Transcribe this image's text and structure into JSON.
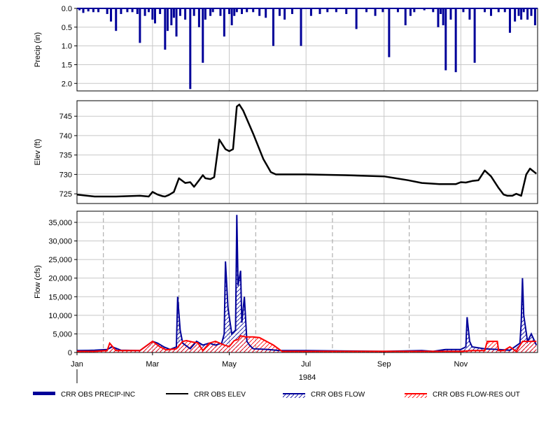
{
  "chart_data": [
    {
      "type": "bar",
      "ylabel": "Precip (in)",
      "ylim": [
        2.2,
        0.0
      ],
      "y_inverted": true,
      "yticks": [
        "0.0",
        "0.5",
        "1.0",
        "1.5",
        "2.0"
      ],
      "grid": true,
      "series": [
        {
          "name": "CRR OBS PRECIP-INC",
          "color": "#000099",
          "x": [
            "1984-01-03",
            "1984-01-06",
            "1984-01-10",
            "1984-01-14",
            "1984-01-18",
            "1984-01-25",
            "1984-01-28",
            "1984-02-01",
            "1984-02-05",
            "1984-02-10",
            "1984-02-14",
            "1984-02-18",
            "1984-02-20",
            "1984-02-24",
            "1984-02-27",
            "1984-03-01",
            "1984-03-03",
            "1984-03-07",
            "1984-03-11",
            "1984-03-13",
            "1984-03-16",
            "1984-03-18",
            "1984-03-20",
            "1984-03-23",
            "1984-03-27",
            "1984-03-31",
            "1984-04-03",
            "1984-04-07",
            "1984-04-10",
            "1984-04-12",
            "1984-04-16",
            "1984-04-18",
            "1984-04-24",
            "1984-04-27",
            "1984-05-01",
            "1984-05-03",
            "1984-05-05",
            "1984-05-07",
            "1984-05-11",
            "1984-05-15",
            "1984-05-20",
            "1984-05-25",
            "1984-05-30",
            "1984-06-05",
            "1984-06-10",
            "1984-06-14",
            "1984-06-20",
            "1984-06-27",
            "1984-07-05",
            "1984-07-12",
            "1984-07-18",
            "1984-07-25",
            "1984-08-02",
            "1984-08-10",
            "1984-08-18",
            "1984-08-25",
            "1984-08-31",
            "1984-09-05",
            "1984-09-12",
            "1984-09-18",
            "1984-09-22",
            "1984-09-25",
            "1984-10-03",
            "1984-10-10",
            "1984-10-14",
            "1984-10-16",
            "1984-10-18",
            "1984-10-20",
            "1984-10-24",
            "1984-10-28",
            "1984-11-03",
            "1984-11-08",
            "1984-11-12",
            "1984-11-20",
            "1984-11-25",
            "1984-12-01",
            "1984-12-06",
            "1984-12-10",
            "1984-12-14",
            "1984-12-17",
            "1984-12-19",
            "1984-12-21",
            "1984-12-24",
            "1984-12-27",
            "1984-12-30"
          ],
          "values": [
            0.05,
            0.12,
            0.08,
            0.1,
            0.1,
            0.15,
            0.35,
            0.6,
            0.15,
            0.1,
            0.1,
            0.15,
            0.92,
            0.2,
            0.1,
            0.3,
            0.4,
            0.15,
            1.1,
            0.6,
            0.45,
            0.25,
            0.75,
            0.2,
            0.3,
            2.15,
            0.2,
            0.5,
            1.45,
            0.3,
            0.2,
            0.1,
            0.2,
            0.75,
            0.15,
            0.45,
            0.2,
            0.1,
            0.15,
            0.1,
            0.1,
            0.2,
            0.25,
            1.0,
            0.2,
            0.3,
            0.15,
            1.0,
            0.2,
            0.15,
            0.1,
            0.1,
            0.15,
            0.55,
            0.1,
            0.2,
            0.1,
            1.3,
            0.1,
            0.45,
            0.2,
            0.1,
            0.05,
            0.1,
            0.5,
            0.15,
            0.45,
            1.65,
            0.3,
            1.7,
            0.1,
            0.3,
            1.45,
            0.1,
            0.2,
            0.1,
            0.1,
            0.65,
            0.35,
            0.2,
            0.3,
            0.1,
            0.3,
            0.2,
            0.45
          ]
        }
      ]
    },
    {
      "type": "line",
      "ylabel": "Elev (ft)",
      "ylim": [
        722.5,
        749
      ],
      "yticks": [
        "725",
        "730",
        "735",
        "740",
        "745"
      ],
      "grid": true,
      "series": [
        {
          "name": "CRR OBS ELEV",
          "color": "#000000",
          "x": [
            "1984-01-01",
            "1984-01-15",
            "1984-02-01",
            "1984-02-20",
            "1984-02-27",
            "1984-03-01",
            "1984-03-05",
            "1984-03-09",
            "1984-03-11",
            "1984-03-14",
            "1984-03-18",
            "1984-03-22",
            "1984-03-27",
            "1984-03-31",
            "1984-04-03",
            "1984-04-07",
            "1984-04-10",
            "1984-04-12",
            "1984-04-16",
            "1984-04-19",
            "1984-04-23",
            "1984-04-28",
            "1984-05-01",
            "1984-05-04",
            "1984-05-07",
            "1984-05-09",
            "1984-05-12",
            "1984-05-20",
            "1984-05-28",
            "1984-06-03",
            "1984-06-07",
            "1984-06-15",
            "1984-07-01",
            "1984-08-01",
            "1984-09-01",
            "1984-09-20",
            "1984-10-01",
            "1984-10-15",
            "1984-10-20",
            "1984-10-28",
            "1984-11-01",
            "1984-11-05",
            "1984-11-10",
            "1984-11-15",
            "1984-11-20",
            "1984-11-25",
            "1984-12-01",
            "1984-12-05",
            "1984-12-08",
            "1984-12-12",
            "1984-12-15",
            "1984-12-19",
            "1984-12-23",
            "1984-12-26",
            "1984-12-31"
          ],
          "values": [
            724.8,
            724.3,
            724.3,
            724.5,
            724.3,
            725.5,
            724.8,
            724.4,
            724.3,
            724.7,
            725.5,
            729.0,
            727.8,
            728.0,
            726.8,
            728.5,
            729.8,
            729.0,
            728.8,
            729.3,
            739.0,
            736.5,
            736.0,
            736.5,
            747.5,
            748.0,
            746.5,
            740.5,
            734.0,
            730.6,
            730.0,
            730.0,
            730.0,
            729.8,
            729.5,
            728.5,
            727.8,
            727.5,
            727.5,
            727.5,
            728.0,
            727.9,
            728.3,
            728.5,
            731.0,
            729.5,
            726.5,
            724.8,
            724.5,
            724.5,
            725.0,
            724.5,
            730.0,
            731.5,
            730.2
          ]
        }
      ]
    },
    {
      "type": "area",
      "ylabel": "Flow (cfs)",
      "ylim": [
        0,
        38000
      ],
      "yticks": [
        "0",
        "5,000",
        "10,000",
        "15,000",
        "20,000",
        "25,000",
        "30,000",
        "35,000"
      ],
      "xlabel": "1984",
      "xticks": [
        "Jan",
        "Mar",
        "May",
        "Jul",
        "Sep",
        "Nov"
      ],
      "grid": true,
      "series": [
        {
          "name": "CRR OBS FLOW",
          "color": "#000099",
          "x": [
            "1984-01-01",
            "1984-01-15",
            "1984-01-25",
            "1984-01-29",
            "1984-02-05",
            "1984-02-20",
            "1984-03-01",
            "1984-03-05",
            "1984-03-10",
            "1984-03-15",
            "1984-03-20",
            "1984-03-21",
            "1984-03-23",
            "1984-03-25",
            "1984-03-31",
            "1984-04-05",
            "1984-04-10",
            "1984-04-15",
            "1984-04-20",
            "1984-04-25",
            "1984-04-27",
            "1984-04-28",
            "1984-04-30",
            "1984-05-03",
            "1984-05-06",
            "1984-05-07",
            "1984-05-08",
            "1984-05-10",
            "1984-05-11",
            "1984-05-13",
            "1984-05-15",
            "1984-05-17",
            "1984-05-20",
            "1984-06-01",
            "1984-06-10",
            "1984-07-01",
            "1984-08-01",
            "1984-09-01",
            "1984-10-01",
            "1984-10-10",
            "1984-10-20",
            "1984-11-01",
            "1984-11-05",
            "1984-11-06",
            "1984-11-08",
            "1984-11-10",
            "1984-11-20",
            "1984-12-01",
            "1984-12-10",
            "1984-12-18",
            "1984-12-19",
            "1984-12-20",
            "1984-12-21",
            "1984-12-24",
            "1984-12-27",
            "1984-12-31"
          ],
          "values": [
            500,
            600,
            800,
            1500,
            600,
            500,
            3000,
            2500,
            1500,
            800,
            1500,
            15000,
            6000,
            2500,
            1000,
            3000,
            2000,
            2500,
            2000,
            2500,
            5000,
            24500,
            12000,
            5000,
            6000,
            37000,
            18000,
            22000,
            8000,
            15000,
            3000,
            2000,
            1000,
            800,
            500,
            500,
            400,
            300,
            500,
            300,
            800,
            800,
            1500,
            9500,
            3000,
            1500,
            1000,
            800,
            600,
            2500,
            8000,
            20000,
            10000,
            3000,
            5000,
            2000
          ]
        },
        {
          "name": "CRR OBS FLOW-RES OUT",
          "color": "#ff0000",
          "x": [
            "1984-01-01",
            "1984-01-15",
            "1984-01-25",
            "1984-01-27",
            "1984-02-01",
            "1984-02-20",
            "1984-03-01",
            "1984-03-07",
            "1984-03-12",
            "1984-03-20",
            "1984-03-25",
            "1984-03-28",
            "1984-04-02",
            "1984-04-06",
            "1984-04-10",
            "1984-04-15",
            "1984-04-20",
            "1984-04-27",
            "1984-05-01",
            "1984-05-05",
            "1984-05-08",
            "1984-05-10",
            "1984-05-14",
            "1984-05-20",
            "1984-05-25",
            "1984-06-05",
            "1984-06-12",
            "1984-07-01",
            "1984-08-01",
            "1984-09-01",
            "1984-10-01",
            "1984-11-01",
            "1984-11-10",
            "1984-11-20",
            "1984-11-22",
            "1984-11-30",
            "1984-12-01",
            "1984-12-05",
            "1984-12-10",
            "1984-12-15",
            "1984-12-20",
            "1984-12-25",
            "1984-12-31"
          ],
          "values": [
            300,
            300,
            500,
            2500,
            500,
            500,
            3000,
            1500,
            700,
            1000,
            3000,
            3200,
            2800,
            2600,
            500,
            2500,
            3000,
            2000,
            1600,
            3200,
            3500,
            4500,
            4200,
            4200,
            4000,
            2000,
            300,
            300,
            300,
            300,
            300,
            300,
            500,
            500,
            3000,
            3000,
            500,
            500,
            1500,
            300,
            3000,
            3000,
            3000
          ]
        }
      ]
    }
  ],
  "legend": [
    {
      "name": "CRR OBS PRECIP-INC",
      "style": "thick-bar"
    },
    {
      "name": "CRR OBS ELEV",
      "style": "line"
    },
    {
      "name": "CRR OBS FLOW",
      "style": "hatched-line"
    },
    {
      "name": "CRR OBS FLOW-RES OUT",
      "style": "hatched-line"
    }
  ],
  "colors": {
    "precip": "#000099",
    "elev": "#000000",
    "flow": "#000099",
    "res_out": "#ff0000",
    "grid": "#c8c8c8",
    "dashed_grid": "#a0a0a0"
  }
}
